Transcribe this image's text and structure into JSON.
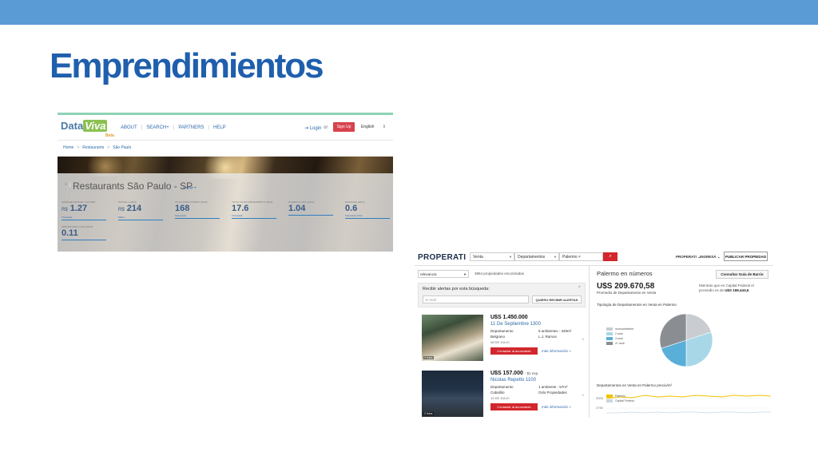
{
  "slide": {
    "title": "Emprendimientos"
  },
  "dataviva": {
    "logo": {
      "data": "Data",
      "viva": "Viva",
      "beta": "Beta"
    },
    "nav": [
      "ABOUT",
      "SEARCH+",
      "PARTNERS",
      "HELP"
    ],
    "login": "Login",
    "or": "or",
    "signup": "Sign Up",
    "language": "English",
    "breadcrumb": [
      "Home",
      "Restaurants",
      "São Paulo"
    ],
    "place_title": "Restaurants São Paulo - SP",
    "change_link": "change ▾",
    "stats": [
      {
        "label": "AVERAGE MONTHLY INCOME",
        "currency": "R$",
        "value": "1.27",
        "unit": "Thousand"
      },
      {
        "label": "PAYROLL (2014)",
        "currency": "R$",
        "value": "214",
        "unit": "Million"
      },
      {
        "label": "TOTAL EMPLOYMENT (2014)",
        "currency": "",
        "value": "168",
        "unit": "Thousand"
      },
      {
        "label": "TOTAL OF ESTABLISHMENTS (2014)",
        "currency": "",
        "value": "17.6",
        "unit": "Thousand"
      },
      {
        "label": "DOMESTIC RCA (2014)",
        "currency": "",
        "value": "1.04",
        "unit": ""
      },
      {
        "label": "DISTANCE (2014)",
        "currency": "",
        "value": "0.6",
        "unit": "Thousand of the"
      },
      {
        "label": "OPPORTUNITY GAIN (2014)",
        "currency": "",
        "value": "0.11",
        "unit": ""
      }
    ]
  },
  "properati": {
    "logo": "PROPERATI",
    "search": {
      "operation": "Venta",
      "type": "Departamentos",
      "location": "Palermo"
    },
    "right_links": {
      "brand": "PROPERATI",
      "login": "INGRESÁ"
    },
    "publish_label": "PUBLICAR PROPIEDAD",
    "sort": "relevancia",
    "count": "3864 propiedades encontradas",
    "alert": {
      "title": "Recibir alertas por esta búsqueda:",
      "email_placeholder": "E-mail",
      "button": "QUIERO RECIBIR ALERTAS"
    },
    "listings": [
      {
        "price": "U$S 1.450.000",
        "expensas": "",
        "address": "11 De Septiembre 1300",
        "type": "Departamento",
        "neighborhood": "Belgrano",
        "date": "08 DE JULIO",
        "rooms": "5 ambientes - 349m²",
        "agency": "L.J. Ramos",
        "photos": "9 fotos",
        "contact": "Contactar al anunciante",
        "more": "más información »"
      },
      {
        "price": "U$S 157.000",
        "expensas": "- $1 exp.",
        "address": "Nicolas Repetto 1100",
        "type": "Departamento",
        "neighborhood": "Caballito",
        "date": "12 DE JULIO",
        "rooms": "1 ambiente - 57m²",
        "agency": "Oslo Propiedades",
        "photos": "2 fotos",
        "contact": "Contactar al anunciante",
        "more": "más información »"
      }
    ],
    "panel": {
      "title": "Palermo en números",
      "guide_button": "Consultar Guía de Barrio",
      "average": "U$S 209.670,58",
      "average_sub": "Promedio de Departamento en Venta",
      "compare_text": "Mientras que en Capital Federal el promedio es de",
      "compare_value": "U$S 168.444,6",
      "tipologia_title": "Tipología de Departamentos en Venta en Palermo",
      "price_title": "Departamentos en Venta en Palermo precio/m²",
      "price_legend": [
        "Palermo",
        "Capital Federal"
      ],
      "price_ticks": [
        "3000",
        "2750"
      ]
    }
  },
  "chart_data": {
    "type": "pie",
    "title": "Tipología de Departamentos en Venta en Palermo",
    "categories": [
      "monoambiente",
      "2 amb",
      "3 amb",
      "4+ amb"
    ],
    "values": [
      20,
      30,
      20,
      30
    ],
    "colors": [
      "#c9cdd1",
      "#a8d8e8",
      "#5aafd9",
      "#8a8e92"
    ]
  },
  "colors": {
    "accent": "#1f5fad",
    "top_bar": "#5b9bd5",
    "properati_red": "#d2272d"
  }
}
